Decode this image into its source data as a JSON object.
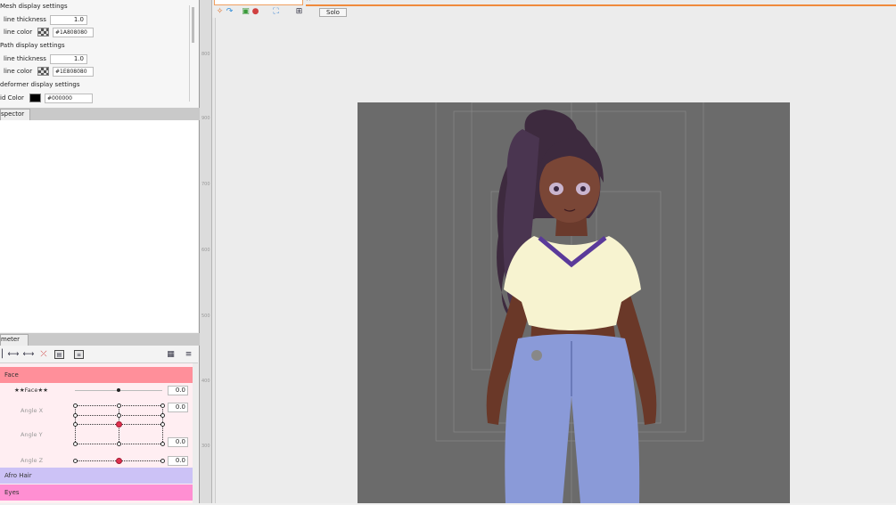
{
  "settings": {
    "mesh_header": "Mesh display settings",
    "mesh_thickness_label": "line thickness",
    "mesh_thickness_value": "1.0",
    "mesh_color_label": "line color",
    "mesh_color_hex": "#1A808080",
    "path_header": "Path display settings",
    "path_thickness_label": "line thickness",
    "path_thickness_value": "1.0",
    "path_color_label": "line color",
    "path_color_hex": "#1E808080",
    "deformer_header": "deformer display settings",
    "grid_color_label": "id Color",
    "grid_color_hex": "#000000"
  },
  "inspector_tab": "spector",
  "parameter_tab": "meter",
  "groups": {
    "face": "Face",
    "afro_hair": "Afro Hair",
    "eyes": "Eyes"
  },
  "params": {
    "face_star": "★★Face★★",
    "face_star_value": "0.0",
    "angle_x": "Angle X",
    "angle_x_value": "0.0",
    "angle_y": "Angle Y",
    "angle_y_value": "0.0",
    "angle_z": "Angle Z",
    "angle_z_value": "0.0"
  },
  "toolbar": {
    "solo_label": "Solo"
  },
  "ruler_labels": [
    "800",
    "900",
    "700",
    "600",
    "500",
    "400",
    "300"
  ],
  "colors": {
    "face_group": "#ff8f9a",
    "afro_hair_group": "#ccc2f6",
    "eyes_group": "#ff8fd2",
    "accent_orange": "#f08a3c",
    "canvas_bg": "#6b6b6b"
  }
}
